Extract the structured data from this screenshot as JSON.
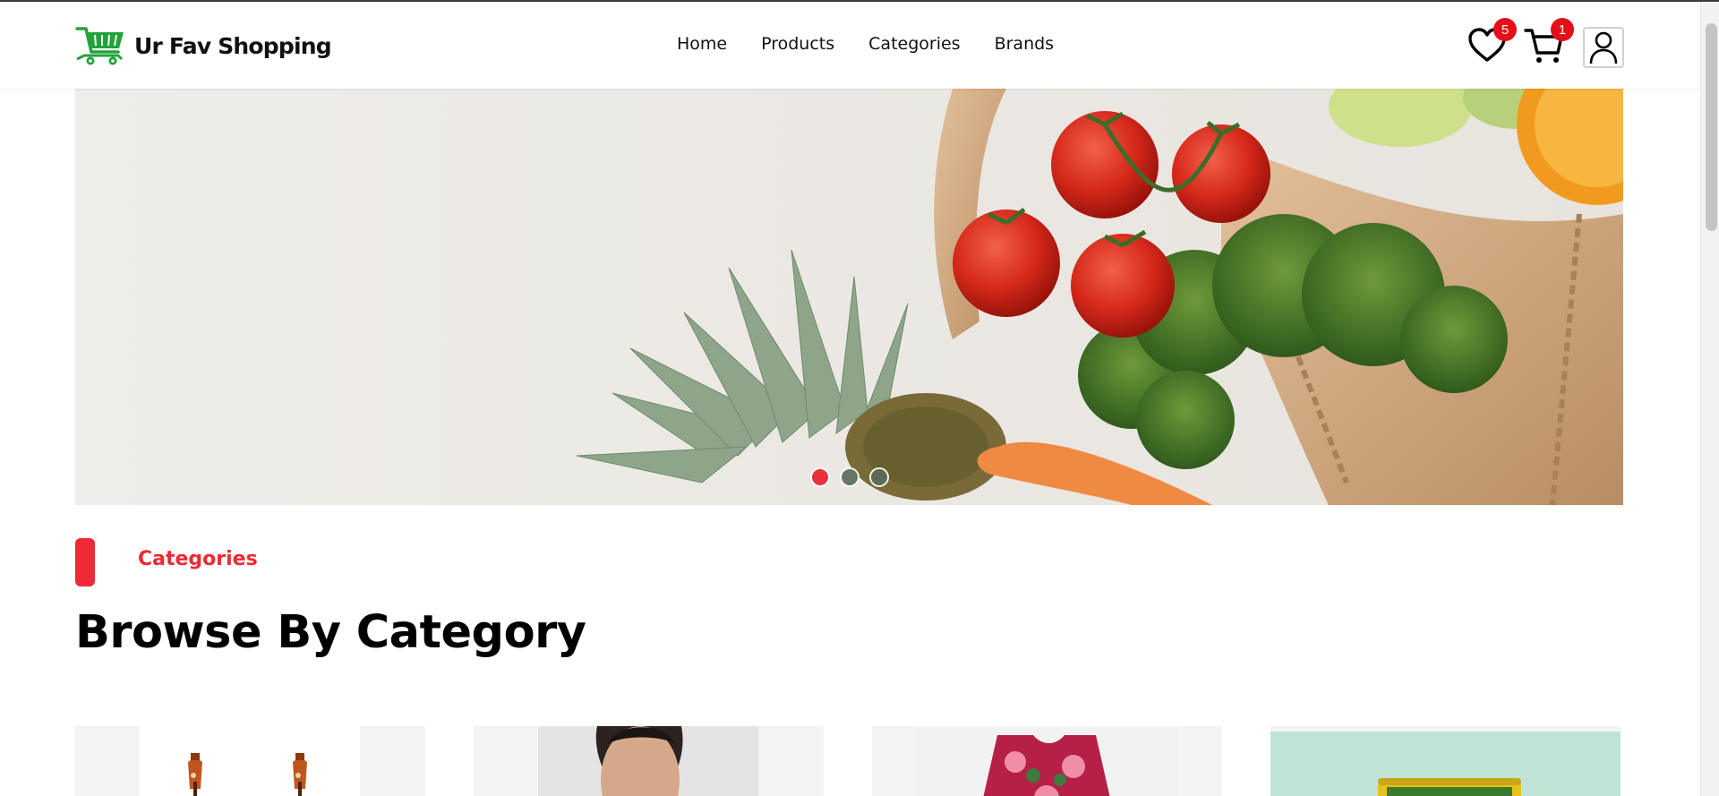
{
  "brand": {
    "name": "Ur Fav Shopping",
    "logo_icon": "shopping-cart-logo-icon",
    "logo_color": "#22a33a"
  },
  "nav": {
    "links": [
      {
        "label": "Home"
      },
      {
        "label": "Products"
      },
      {
        "label": "Categories"
      },
      {
        "label": "Brands"
      }
    ]
  },
  "header_icons": {
    "wishlist": {
      "icon": "heart-icon",
      "count": "5"
    },
    "cart": {
      "icon": "cart-icon",
      "count": "1"
    },
    "profile": {
      "icon": "user-icon"
    }
  },
  "hero": {
    "slides_total": 3,
    "active_slide": 1,
    "image": "grocery-bag-vegetables"
  },
  "categories_section": {
    "label": "Categories",
    "title": "Browse By Category",
    "cards": [
      {
        "image": "guitars"
      },
      {
        "image": "men-fashion"
      },
      {
        "image": "women-floral-dress"
      },
      {
        "image": "food-can"
      }
    ]
  },
  "colors": {
    "accent": "#ef2a34",
    "badge": "#e3101a",
    "brand_green": "#22a33a"
  }
}
